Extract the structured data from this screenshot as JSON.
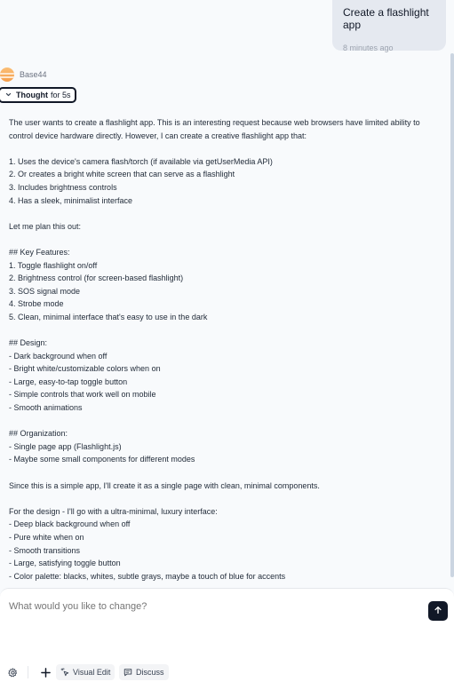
{
  "user_message": {
    "text": "Create a flashlight app",
    "time": "8 minutes ago"
  },
  "assistant": {
    "name": "Base44",
    "thought_label": "Thought",
    "thought_duration": "for 5s",
    "thought_lines": [
      "The user wants to create a flashlight app. This is an interesting request because web browsers have limited ability to",
      "control device hardware directly. However, I can create a creative flashlight app that:",
      "",
      "1. Uses the device's camera flash/torch (if available via getUserMedia API)",
      "2. Or creates a bright white screen that can serve as a flashlight",
      "3. Includes brightness controls",
      "4. Has a sleek, minimalist interface",
      "",
      "Let me plan this out:",
      "",
      "## Key Features:",
      "1. Toggle flashlight on/off",
      "2. Brightness control (for screen-based flashlight)",
      "3. SOS signal mode",
      "4. Strobe mode",
      "5. Clean, minimal interface that's easy to use in the dark",
      "",
      "## Design:",
      "- Dark background when off",
      "- Bright white/customizable colors when on",
      "- Large, easy-to-tap toggle button",
      "- Simple controls that work well on mobile",
      "- Smooth animations",
      "",
      "## Organization:",
      "- Single page app (Flashlight.js)",
      "- Maybe some small components for different modes",
      "",
      "Since this is a simple app, I'll create it as a single page with clean, minimal components.",
      "",
      "For the design - I'll go with a ultra-minimal, luxury interface:",
      "- Deep black background when off",
      "- Pure white when on",
      "- Smooth transitions",
      "- Large, satisfying toggle button",
      "- Color palette: blacks, whites, subtle grays, maybe a touch of blue for accents"
    ]
  },
  "composer": {
    "placeholder": "What would you like to change?"
  },
  "toolbar": {
    "visual_edit_label": "Visual Edit",
    "discuss_label": "Discuss"
  },
  "icons": {
    "settings": "gear-icon",
    "add": "plus-icon",
    "visual_edit": "sparkle-cursor-icon",
    "discuss": "chat-bubble-icon",
    "send": "arrow-up-icon",
    "thought_toggle": "chevron-down-icon"
  }
}
